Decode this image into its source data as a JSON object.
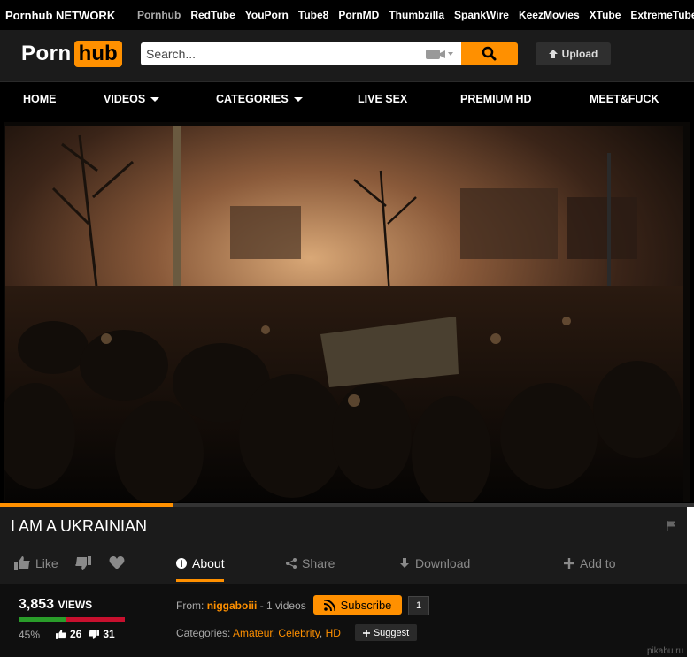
{
  "network": {
    "brand": "Pornhub NETWORK",
    "links": [
      "Pornhub",
      "RedTube",
      "YouPorn",
      "Tube8",
      "PornMD",
      "Thumbzilla",
      "SpankWire",
      "KeezMovies",
      "XTube",
      "ExtremeTube"
    ]
  },
  "header": {
    "logo_part1": "Porn",
    "logo_part2": "hub",
    "search_placeholder": "Search...",
    "upload_label": "Upload"
  },
  "nav": [
    "HOME",
    "VIDEOS",
    "CATEGORIES",
    "LIVE SEX",
    "PREMIUM HD",
    "MEET&FUCK"
  ],
  "video": {
    "title": "I AM A UKRAINIAN",
    "progress_fraction": 0.25
  },
  "actions": {
    "like": "Like",
    "about": "About",
    "share": "Share",
    "download": "Download",
    "add_to": "Add to"
  },
  "stats": {
    "views_count": "3,853",
    "views_label": "VIEWS",
    "rating_percent": "45%",
    "rating_fraction": 0.45,
    "up_votes": "26",
    "down_votes": "31"
  },
  "uploader": {
    "from_label": "From:",
    "name": "niggaboiii",
    "videos_text": "- 1 videos",
    "subscribe_label": "Subscribe",
    "subscriber_count": "1"
  },
  "categories": {
    "label": "Categories:",
    "items": [
      "Amateur",
      "Celebrity",
      "HD"
    ],
    "suggest_label": "Suggest"
  },
  "watermark": "pikabu.ru",
  "colors": {
    "accent": "#ff9000",
    "background": "#1b1b1b"
  }
}
